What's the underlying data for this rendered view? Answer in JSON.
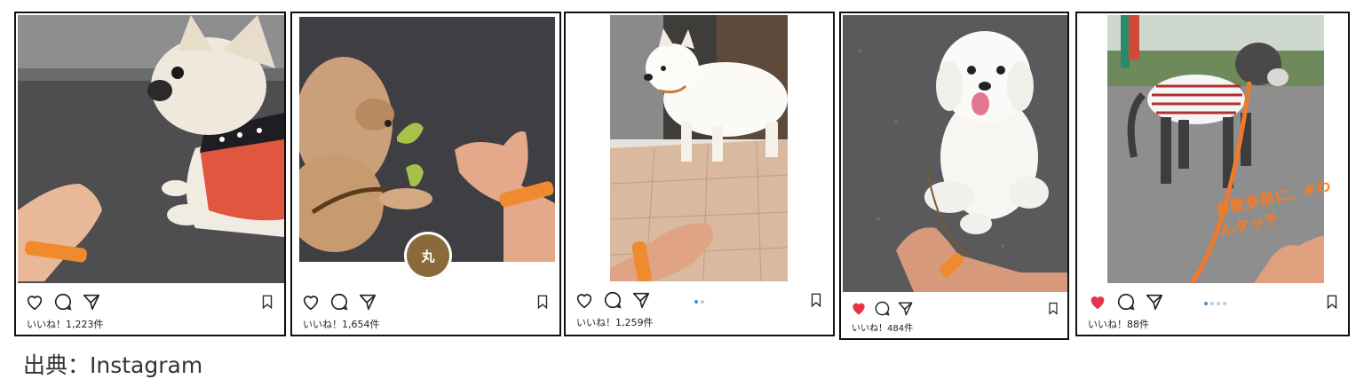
{
  "posts": [
    {
      "likes": "いいね！1,223件",
      "liked": false,
      "has_dots": false
    },
    {
      "likes": "いいね！1,654件",
      "liked": false,
      "has_dots": false,
      "badge_text": "丸"
    },
    {
      "likes": "いいね！1,259件",
      "liked": false,
      "has_dots": true
    },
    {
      "likes": "いいね！484件",
      "liked": true,
      "has_dots": false
    },
    {
      "likes": "いいね！88件",
      "liked": true,
      "has_dots": true,
      "overlay_text": "お散歩前に、#わんタッチ"
    }
  ],
  "source_caption": "出典：Instagram",
  "colors": {
    "heart_liked": "#e8344a",
    "wristband": "#f08a2e",
    "asphalt": "#5a5a5a",
    "dot_active": "#3a8ee6",
    "border": "#111111"
  },
  "icons": [
    "heart-icon",
    "comment-icon",
    "share-icon",
    "bookmark-icon"
  ]
}
